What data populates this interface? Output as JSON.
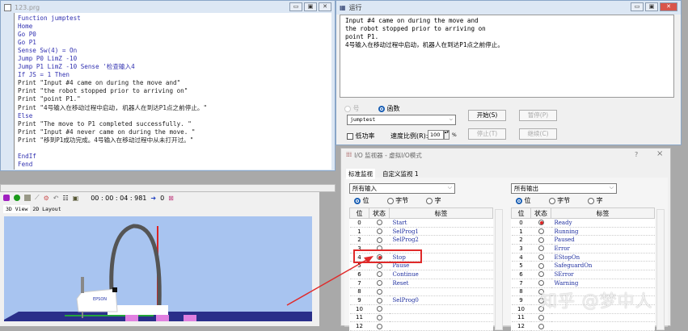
{
  "editor": {
    "title": "123.prg",
    "lines": [
      "Function jumptest",
      "Home",
      "Go P0",
      "Go P1",
      "Sense Sw(4) = On",
      "Jump P0 LimZ -10",
      "Jump P1 LimZ -10 Sense '检查输入4",
      "If JS = 1 Then",
      "Print \"Input #4 came on during the move and\"",
      "Print \"the robot stopped prior to arriving on\"",
      "Print \"point P1.\"",
      "Print \"4号输入在移动过程中启动, 机器人在到达P1点之前停止。\"",
      "Else",
      "Print \"The move to P1 completed successfully. \"",
      "Print \"Input #4 never came on during the move. \"",
      "Print \"移到P1成功完成。4号输入在移动过程中从未打开过。\"",
      "",
      "EndIf",
      "Fend"
    ]
  },
  "sim": {
    "timer": "00 : 00 : 04 : 981",
    "counter": "0",
    "tabs": [
      "3D View",
      "2D Layout"
    ],
    "robot_brand": "EPSON"
  },
  "run": {
    "title": "运行",
    "output": "Input #4 came on during the move and\nthe robot stopped prior to arriving on\npoint P1.\n4号输入在移动过程中启动，机器人在到达P1点之前停止。",
    "radio_number": "号",
    "radio_function": "函数",
    "function_value": "jumptest",
    "low_power": "低功率",
    "speed_label": "速度比例(R):",
    "speed_value": "100",
    "speed_unit": "%",
    "start": "开始(S)",
    "pause": "暂停(P)",
    "stop": "停止(T)",
    "continue": "继续(C)"
  },
  "io": {
    "title": "I/O 监视器 - 虚拟I/O模式",
    "help": "?",
    "close": "×",
    "tabs": [
      "标准监视",
      "自定义监视 1"
    ],
    "input_select": "所有输入",
    "output_select": "所有输出",
    "modes": [
      "位",
      "字节",
      "字"
    ],
    "headers": [
      "位",
      "状态",
      "标签"
    ],
    "inputs": [
      {
        "bit": "0",
        "on": false,
        "label": "Start"
      },
      {
        "bit": "1",
        "on": false,
        "label": "SelProg1"
      },
      {
        "bit": "2",
        "on": false,
        "label": "SelProg2"
      },
      {
        "bit": "3",
        "on": false,
        "label": ""
      },
      {
        "bit": "4",
        "on": true,
        "label": "Stop"
      },
      {
        "bit": "5",
        "on": false,
        "label": "Pause"
      },
      {
        "bit": "6",
        "on": false,
        "label": "Continue"
      },
      {
        "bit": "7",
        "on": false,
        "label": "Reset"
      },
      {
        "bit": "8",
        "on": false,
        "label": ""
      },
      {
        "bit": "9",
        "on": false,
        "label": "SelProg0"
      },
      {
        "bit": "10",
        "on": false,
        "label": ""
      },
      {
        "bit": "11",
        "on": false,
        "label": ""
      },
      {
        "bit": "12",
        "on": false,
        "label": ""
      }
    ],
    "outputs": [
      {
        "bit": "0",
        "on": true,
        "label": "Ready"
      },
      {
        "bit": "1",
        "on": false,
        "label": "Running"
      },
      {
        "bit": "2",
        "on": false,
        "label": "Paused"
      },
      {
        "bit": "3",
        "on": false,
        "label": "Error"
      },
      {
        "bit": "4",
        "on": false,
        "label": "EStopOn"
      },
      {
        "bit": "5",
        "on": false,
        "label": "SafeguardOn"
      },
      {
        "bit": "6",
        "on": false,
        "label": "SError"
      },
      {
        "bit": "7",
        "on": false,
        "label": "Warning"
      },
      {
        "bit": "8",
        "on": false,
        "label": ""
      },
      {
        "bit": "9",
        "on": false,
        "label": ""
      },
      {
        "bit": "10",
        "on": false,
        "label": ""
      },
      {
        "bit": "11",
        "on": false,
        "label": ""
      },
      {
        "bit": "12",
        "on": false,
        "label": ""
      }
    ]
  },
  "watermark": "知乎 @梦中人"
}
